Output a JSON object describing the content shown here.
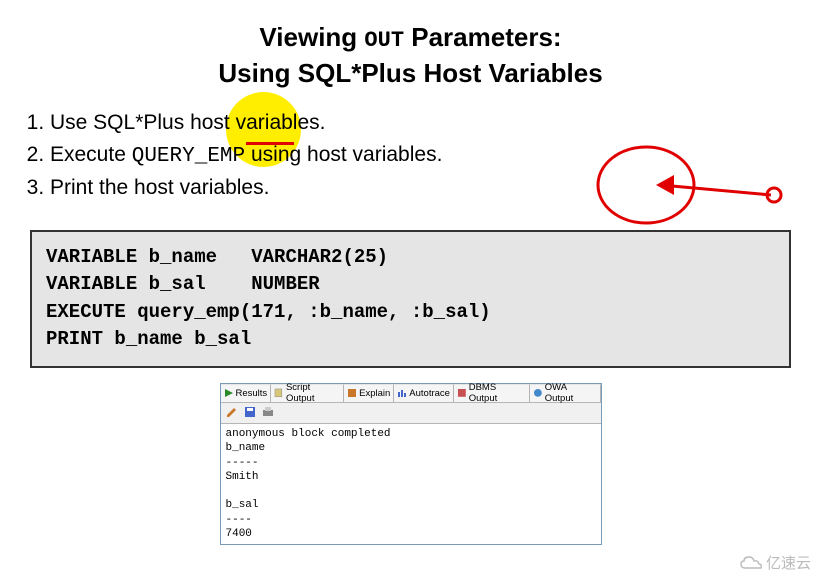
{
  "title": {
    "line1_pre": "Viewing ",
    "line1_code": "OUT",
    "line1_post": " Parameters:",
    "line2": "Using SQL*Plus Host Variables"
  },
  "steps": {
    "s1_pre": "Use SQL*Plus ",
    "s1_host": "host",
    "s1_post": " variables.",
    "s2_pre": "Execute ",
    "s2_code": "QUERY_EMP",
    "s2_post": " using host variables.",
    "s3": "Print the host variables."
  },
  "code_block": "VARIABLE b_name   VARCHAR2(25)\nVARIABLE b_sal    NUMBER\nEXECUTE query_emp(171, :b_name, :b_sal)\nPRINT b_name b_sal",
  "tabs": {
    "results": "Results",
    "script": "Script Output",
    "explain": "Explain",
    "autotrace": "Autotrace",
    "dbms": "DBMS Output",
    "owa": "OWA Output"
  },
  "output_body": "anonymous block completed\nb_name\n-----\nSmith\n\nb_sal\n----\n7400",
  "watermark": "亿速云"
}
